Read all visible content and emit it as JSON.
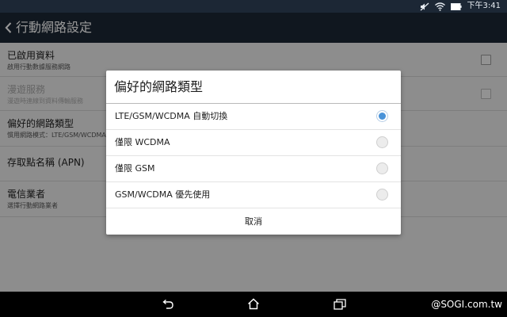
{
  "status_bar": {
    "time": "下午3:41",
    "icons": [
      "mute-icon",
      "wifi-icon",
      "battery-icon"
    ]
  },
  "action_bar": {
    "title": "行動網路設定",
    "back_icon": "chevron-left-icon"
  },
  "settings": {
    "items": [
      {
        "title": "已啟用資料",
        "subtitle": "啟用行動數據服務網路",
        "checkbox": true,
        "enabled": true
      },
      {
        "title": "漫遊服務",
        "subtitle": "漫遊時連線到資料傳輸服務",
        "checkbox": true,
        "enabled": false
      },
      {
        "title": "偏好的網路類型",
        "subtitle": "慣用網路模式：LTE/GSM/WCDMA 自動切換",
        "checkbox": false,
        "enabled": true
      },
      {
        "title": "存取點名稱 (APN)",
        "subtitle": "",
        "checkbox": false,
        "enabled": true
      },
      {
        "title": "電信業者",
        "subtitle": "選擇行動網路業者",
        "checkbox": false,
        "enabled": true
      }
    ]
  },
  "dialog": {
    "title": "偏好的網路類型",
    "options": [
      {
        "label": "LTE/GSM/WCDMA 自動切換",
        "selected": true
      },
      {
        "label": "僅限 WCDMA",
        "selected": false
      },
      {
        "label": "僅限 GSM",
        "selected": false
      },
      {
        "label": "GSM/WCDMA 優先使用",
        "selected": false
      }
    ],
    "cancel_label": "取消"
  },
  "nav_bar": {
    "buttons": [
      "back-icon",
      "home-icon",
      "recents-icon"
    ]
  },
  "watermark": "@SOGI.com.tw",
  "colors": {
    "bar_bg": "#1c2735",
    "accent": "#4a93d8"
  }
}
